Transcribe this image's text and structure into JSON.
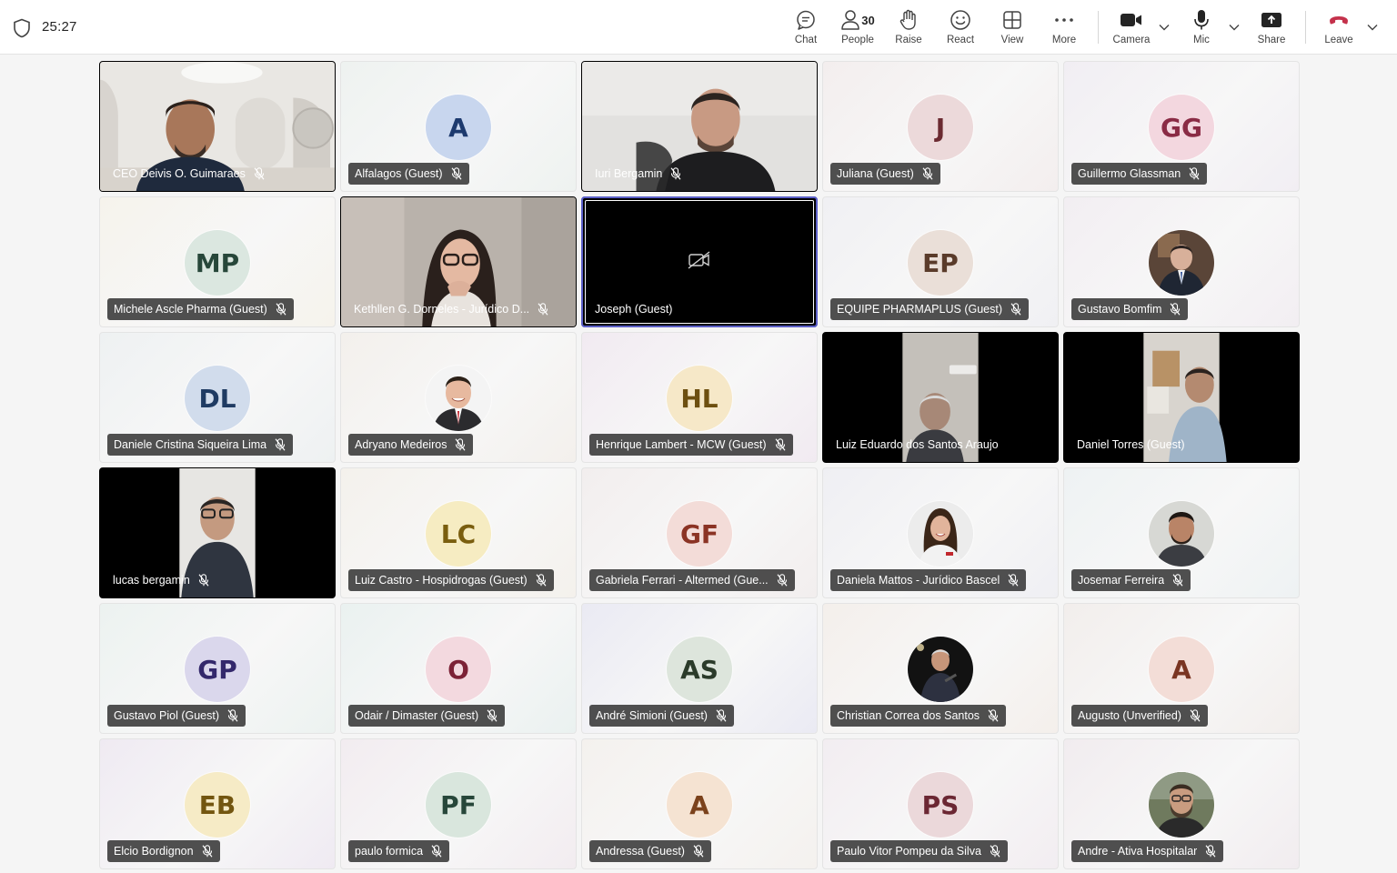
{
  "meeting": {
    "timer": "25:27"
  },
  "toolbar": {
    "chat": "Chat",
    "people": "People",
    "people_count": "30",
    "raise": "Raise",
    "react": "React",
    "view": "View",
    "more": "More",
    "camera": "Camera",
    "mic": "Mic",
    "share": "Share",
    "leave": "Leave"
  },
  "colors": {
    "accent": "#5b5fc7",
    "leave": "#c4314b",
    "nameplate_bg": "#202020"
  },
  "tiles": [
    {
      "name": "CEO Deivis O. Guimaraes",
      "kind": "video",
      "scene": "office"
    },
    {
      "name": "Alfalagos (Guest)",
      "kind": "initials",
      "initials": "A",
      "bg": "#c8d6ee",
      "fg": "#1d3a6e",
      "tile": "#eef2f0"
    },
    {
      "name": "Iuri Bergamin",
      "kind": "video",
      "scene": "man-room"
    },
    {
      "name": "Juliana (Guest)",
      "kind": "initials",
      "initials": "J",
      "bg": "#ecd9da",
      "fg": "#6b2a31",
      "tile": "#f3eeee"
    },
    {
      "name": "Guillermo Glassman",
      "kind": "initials",
      "initials": "GG",
      "bg": "#f3d7df",
      "fg": "#8a2b45",
      "tile": "#f1eef3"
    },
    {
      "name": "Michele Ascle Pharma (Guest)",
      "kind": "initials",
      "initials": "MP",
      "bg": "#dbe7e0",
      "fg": "#27473a",
      "tile": "#f6f3ec"
    },
    {
      "name": "Kethllen G. Dorneles - Jurídico D...",
      "kind": "video",
      "scene": "woman"
    },
    {
      "name": "Joseph (Guest)",
      "kind": "camoff",
      "active": true
    },
    {
      "name": "EQUIPE PHARMAPLUS (Guest)",
      "kind": "initials",
      "initials": "EP",
      "bg": "#eadfd8",
      "fg": "#5a3b2a",
      "tile": "#f0f0f3"
    },
    {
      "name": "Gustavo Bomfim",
      "kind": "photo",
      "photo": "suit",
      "tile": "#f2eef2"
    },
    {
      "name": "Daniele Cristina Siqueira Lima",
      "kind": "initials",
      "initials": "DL",
      "bg": "#d1dcec",
      "fg": "#1f3b63",
      "tile": "#eef1f2"
    },
    {
      "name": "Adryano Medeiros",
      "kind": "photo",
      "photo": "smile",
      "tile": "#f3f0ec"
    },
    {
      "name": "Henrique Lambert - MCW (Guest)",
      "kind": "initials",
      "initials": "HL",
      "bg": "#f6e8c8",
      "fg": "#6d4f10",
      "tile": "#f1eaf1"
    },
    {
      "name": "Luiz Eduardo dos Santos Araujo",
      "kind": "video",
      "scene": "pillar"
    },
    {
      "name": "Daniel Torres (Guest)",
      "kind": "video",
      "scene": "pillar2"
    },
    {
      "name": "lucas bergamin",
      "kind": "video",
      "scene": "pillar3"
    },
    {
      "name": "Luiz Castro - Hospidrogas (Guest)",
      "kind": "initials",
      "initials": "LC",
      "bg": "#f6ecc2",
      "fg": "#7a5e0f",
      "tile": "#f4f1ec"
    },
    {
      "name": "Gabriela Ferrari - Altermed (Gue...",
      "kind": "initials",
      "initials": "GF",
      "bg": "#f3dcd8",
      "fg": "#8b3324",
      "tile": "#f2eeee"
    },
    {
      "name": "Daniela Mattos - Jurídico Bascel",
      "kind": "photo",
      "photo": "woman2",
      "tile": "#efeff3"
    },
    {
      "name": "Josemar Ferreira",
      "kind": "photo",
      "photo": "man2",
      "tile": "#eef2f3"
    },
    {
      "name": "Gustavo Piol (Guest)",
      "kind": "initials",
      "initials": "GP",
      "bg": "#dad7ec",
      "fg": "#33286b",
      "tile": "#ecf2f0"
    },
    {
      "name": "Odair / Dimaster (Guest)",
      "kind": "initials",
      "initials": "O",
      "bg": "#f3d9df",
      "fg": "#7c2236",
      "tile": "#eaf1f0"
    },
    {
      "name": "André Simioni (Guest)",
      "kind": "initials",
      "initials": "AS",
      "bg": "#dde5dc",
      "fg": "#2b3b2a",
      "tile": "#eaeaf3"
    },
    {
      "name": "Christian Correa dos Santos",
      "kind": "photo",
      "photo": "stage",
      "tile": "#f4efeb"
    },
    {
      "name": "Augusto (Unverified)",
      "kind": "initials",
      "initials": "A",
      "bg": "#f3ddd7",
      "fg": "#7a3522",
      "tile": "#f2eeec"
    },
    {
      "name": "Elcio Bordignon",
      "kind": "initials",
      "initials": "EB",
      "bg": "#f6ebc6",
      "fg": "#735610",
      "tile": "#efeaf2"
    },
    {
      "name": "paulo formica",
      "kind": "initials",
      "initials": "PF",
      "bg": "#d9e6dd",
      "fg": "#27473a",
      "tile": "#f2ecf0"
    },
    {
      "name": "Andressa (Guest)",
      "kind": "initials",
      "initials": "A",
      "bg": "#f5e3d2",
      "fg": "#7b421c",
      "tile": "#f4f1ee"
    },
    {
      "name": "Paulo Vitor Pompeu da Silva",
      "kind": "initials",
      "initials": "PS",
      "bg": "#ebd8da",
      "fg": "#6b2733",
      "tile": "#f2edf1"
    },
    {
      "name": "Andre - Ativa Hospitalar",
      "kind": "photo",
      "photo": "bearded",
      "tile": "#f1ecef"
    }
  ]
}
